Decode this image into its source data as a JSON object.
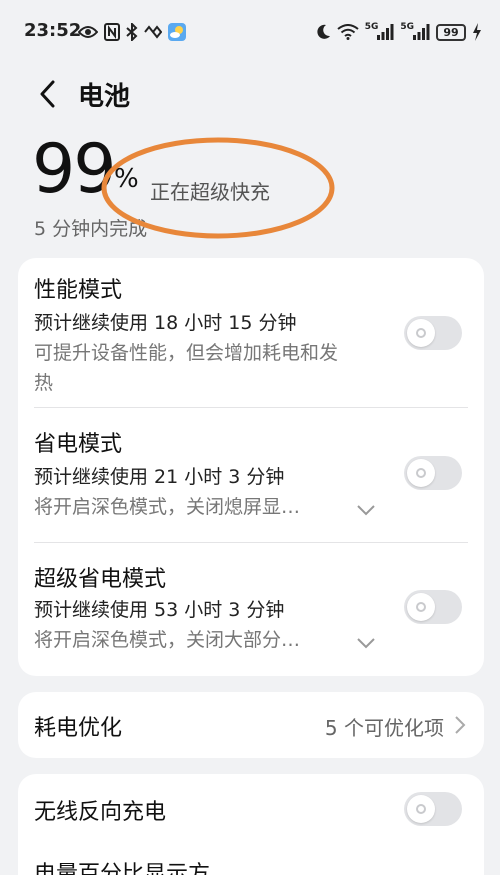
{
  "status_bar": {
    "time": "23:52",
    "left_icons": [
      "eye-icon",
      "nfc-icon",
      "bluetooth-icon",
      "vibrate-icon",
      "weather-app-icon"
    ],
    "right_icons": [
      "moon-icon",
      "wifi-icon",
      "signal-5g-icon",
      "signal-5g-icon",
      "battery-icon",
      "charging-bolt-icon"
    ],
    "signal_label_1": "5G",
    "signal_label_2": "5G",
    "battery_level": "99"
  },
  "header": {
    "back_icon": "chevron-left-icon",
    "title": "电池"
  },
  "battery": {
    "percent": "99",
    "percent_sign": "%",
    "status": "正在超级快充",
    "eta": "5 分钟内完成",
    "highlight_color": "#E8873A"
  },
  "modes": [
    {
      "title": "性能模式",
      "estimate": "预计继续使用 18 小时 15 分钟",
      "description": "可提升设备性能，但会增加耗电和发热",
      "enabled": false
    },
    {
      "title": "省电模式",
      "estimate": "预计继续使用 21 小时 3 分钟",
      "description": "将开启深色模式，关闭熄屏显…",
      "enabled": false
    },
    {
      "title": "超级省电模式",
      "estimate": "预计继续使用 53 小时 3 分钟",
      "description": "将开启深色模式，关闭大部分…",
      "enabled": false
    }
  ],
  "optimize": {
    "title": "耗电优化",
    "value": "5 个可优化项"
  },
  "wireless": {
    "title": "无线反向充电",
    "enabled": false
  },
  "percentage_display": {
    "title": "电量百分比显示方"
  },
  "colors": {
    "background": "#f1f2f4",
    "card": "#ffffff",
    "toggle_off": "#e2e3e6",
    "annotation": "#E8873A"
  }
}
